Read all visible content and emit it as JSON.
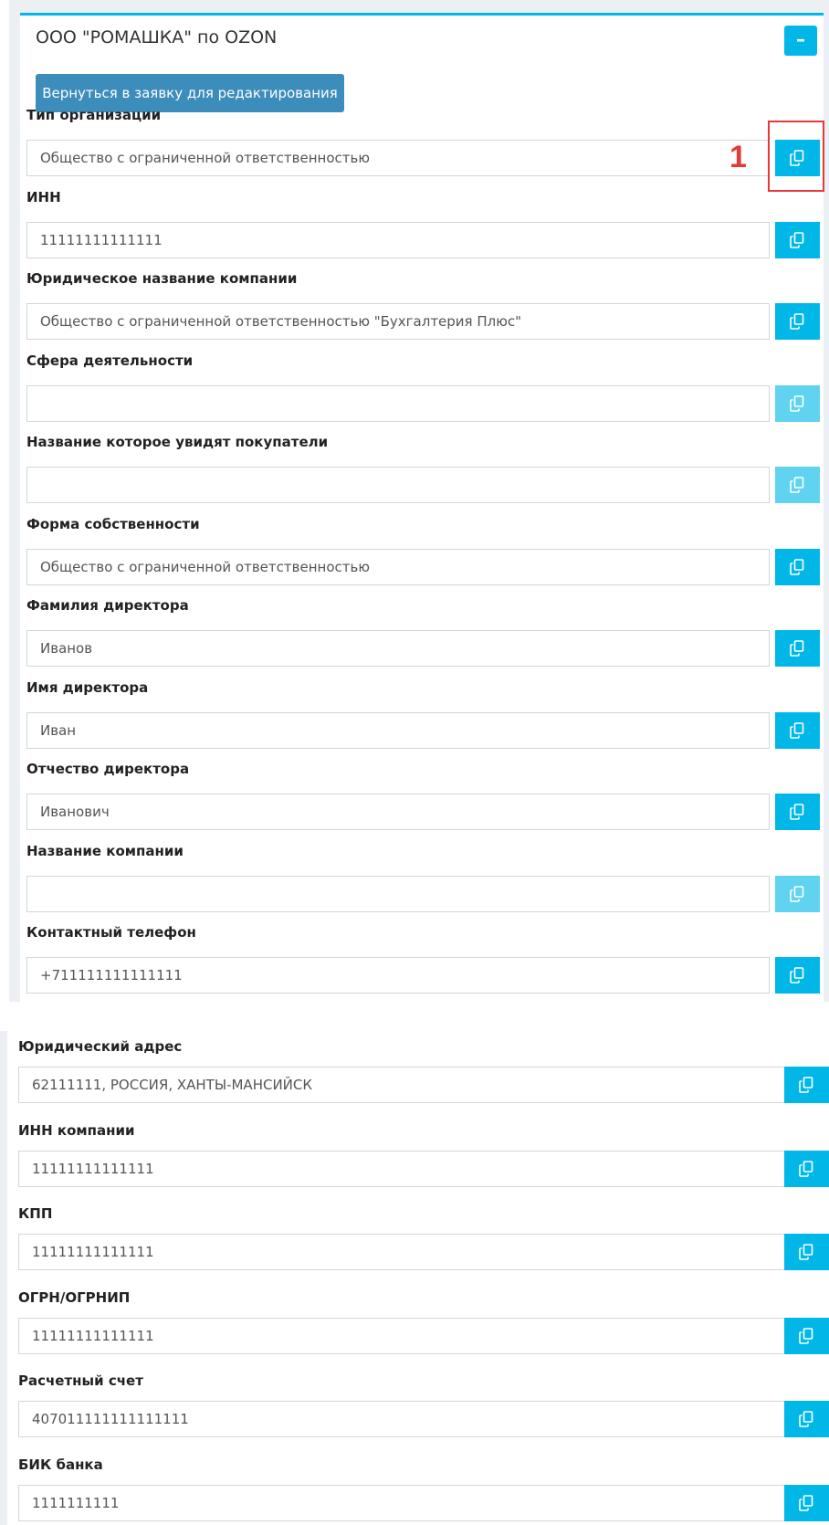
{
  "panel": {
    "title": "ООО \"РОМАШКА\" по OZON",
    "collapse_symbol": "–",
    "back_button_label": "Вернуться в заявку для редактирования"
  },
  "annotation": {
    "number": "1"
  },
  "fields_top": [
    {
      "label": "Тип организации",
      "value": "Общество с ограниченной ответственностью",
      "copy_enabled": true
    },
    {
      "label": "ИНН",
      "value": "11111111111111",
      "copy_enabled": true
    },
    {
      "label": "Юридическое название компании",
      "value": "Общество с ограниченной ответственностью \"Бухгалтерия Плюс\"",
      "copy_enabled": true
    },
    {
      "label": "Сфера деятельности",
      "value": "",
      "copy_enabled": false
    },
    {
      "label": "Название которое увидят покупатели",
      "value": "",
      "copy_enabled": false
    },
    {
      "label": "Форма собственности",
      "value": "Общество с ограниченной ответственностью",
      "copy_enabled": true
    },
    {
      "label": "Фамилия директора",
      "value": "Иванов",
      "copy_enabled": true
    },
    {
      "label": "Имя директора",
      "value": "Иван",
      "copy_enabled": true
    },
    {
      "label": "Отчество директора",
      "value": "Иванович",
      "copy_enabled": true
    },
    {
      "label": "Название компании",
      "value": "",
      "copy_enabled": false
    },
    {
      "label": "Контактный телефон",
      "value": "+711111111111111",
      "copy_enabled": true
    }
  ],
  "fields_bottom": [
    {
      "label": "Юридический адрес",
      "value": "62111111, РОССИЯ, ХАНТЫ-МАНСИЙСК",
      "copy_enabled": true
    },
    {
      "label": "ИНН компании",
      "value": "11111111111111",
      "copy_enabled": true
    },
    {
      "label": "КПП",
      "value": "11111111111111",
      "copy_enabled": true
    },
    {
      "label": "ОГРН/ОГРНИП",
      "value": "11111111111111",
      "copy_enabled": true
    },
    {
      "label": "Расчетный счет",
      "value": "407011111111111111",
      "copy_enabled": true
    },
    {
      "label": "БИК банка",
      "value": "1111111111",
      "copy_enabled": true
    }
  ],
  "colors": {
    "accent": "#00b7e8",
    "accent_disabled": "#5fd3f0",
    "primary_button": "#3c8dbc",
    "annotation": "#e53935"
  },
  "icons": {
    "copy": "copy-icon",
    "collapse": "minus-icon"
  }
}
